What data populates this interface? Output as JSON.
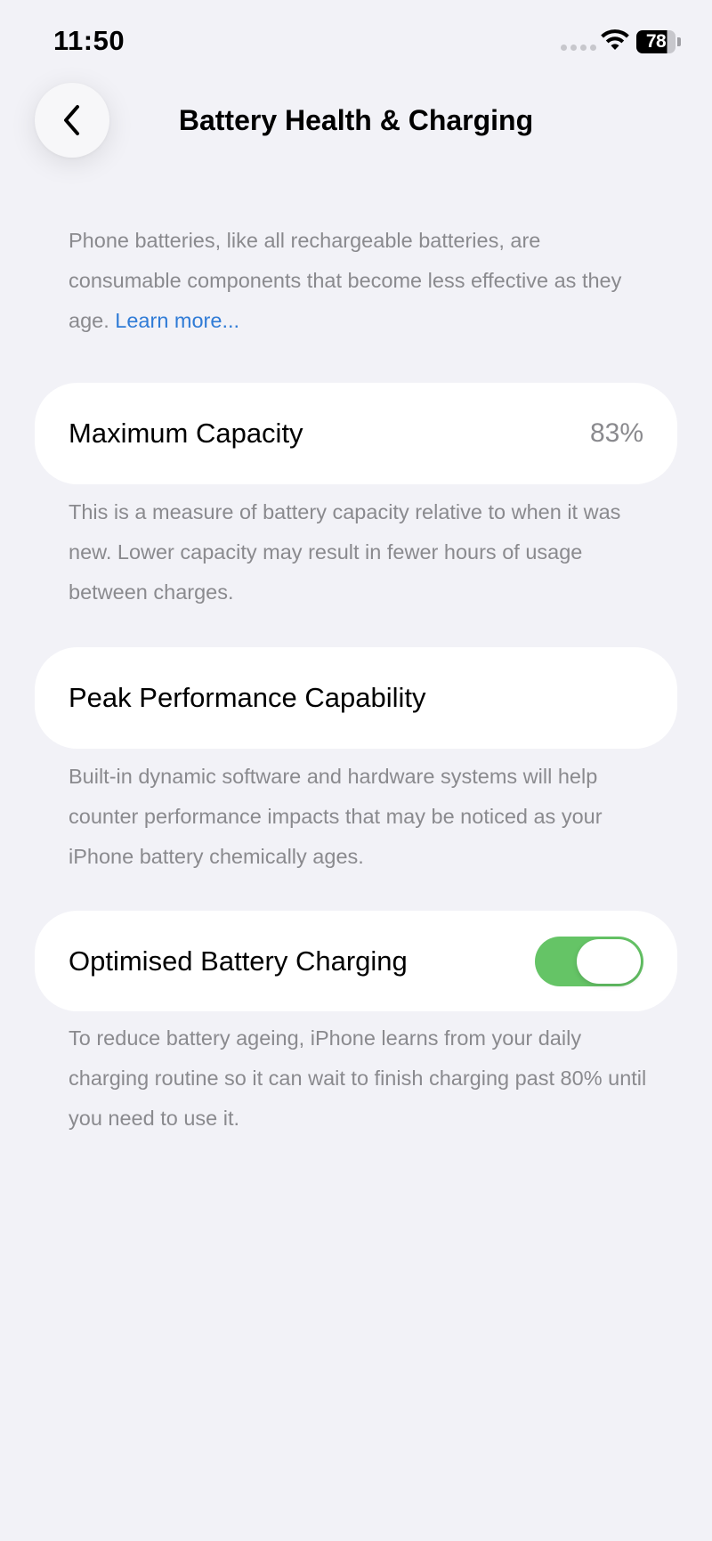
{
  "status_bar": {
    "time": "11:50",
    "battery_level": "78"
  },
  "nav": {
    "title": "Battery Health & Charging",
    "back_icon": "chevron-left-icon"
  },
  "intro": {
    "text": "Phone batteries, like all rechargeable batteries, are consumable components that become less effective as they age. ",
    "link_label": "Learn more..."
  },
  "maximum_capacity": {
    "label": "Maximum Capacity",
    "value": "83%",
    "description": "This is a measure of battery capacity relative to when it was new. Lower capacity may result in fewer hours of usage between charges."
  },
  "peak_performance": {
    "label": "Peak Performance Capability",
    "description": "Built-in dynamic software and hardware systems will help counter performance impacts that may be noticed as your iPhone battery chemically ages."
  },
  "optimised_charging": {
    "label": "Optimised Battery Charging",
    "enabled": true,
    "description": "To reduce battery ageing, iPhone learns from your daily charging routine so it can wait to finish charging past 80% until you need to use it."
  },
  "colors": {
    "background": "#f2f2f7",
    "card": "#ffffff",
    "secondary_text": "#8a8a8e",
    "link": "#2f7bd6",
    "toggle_on": "#65c466"
  }
}
